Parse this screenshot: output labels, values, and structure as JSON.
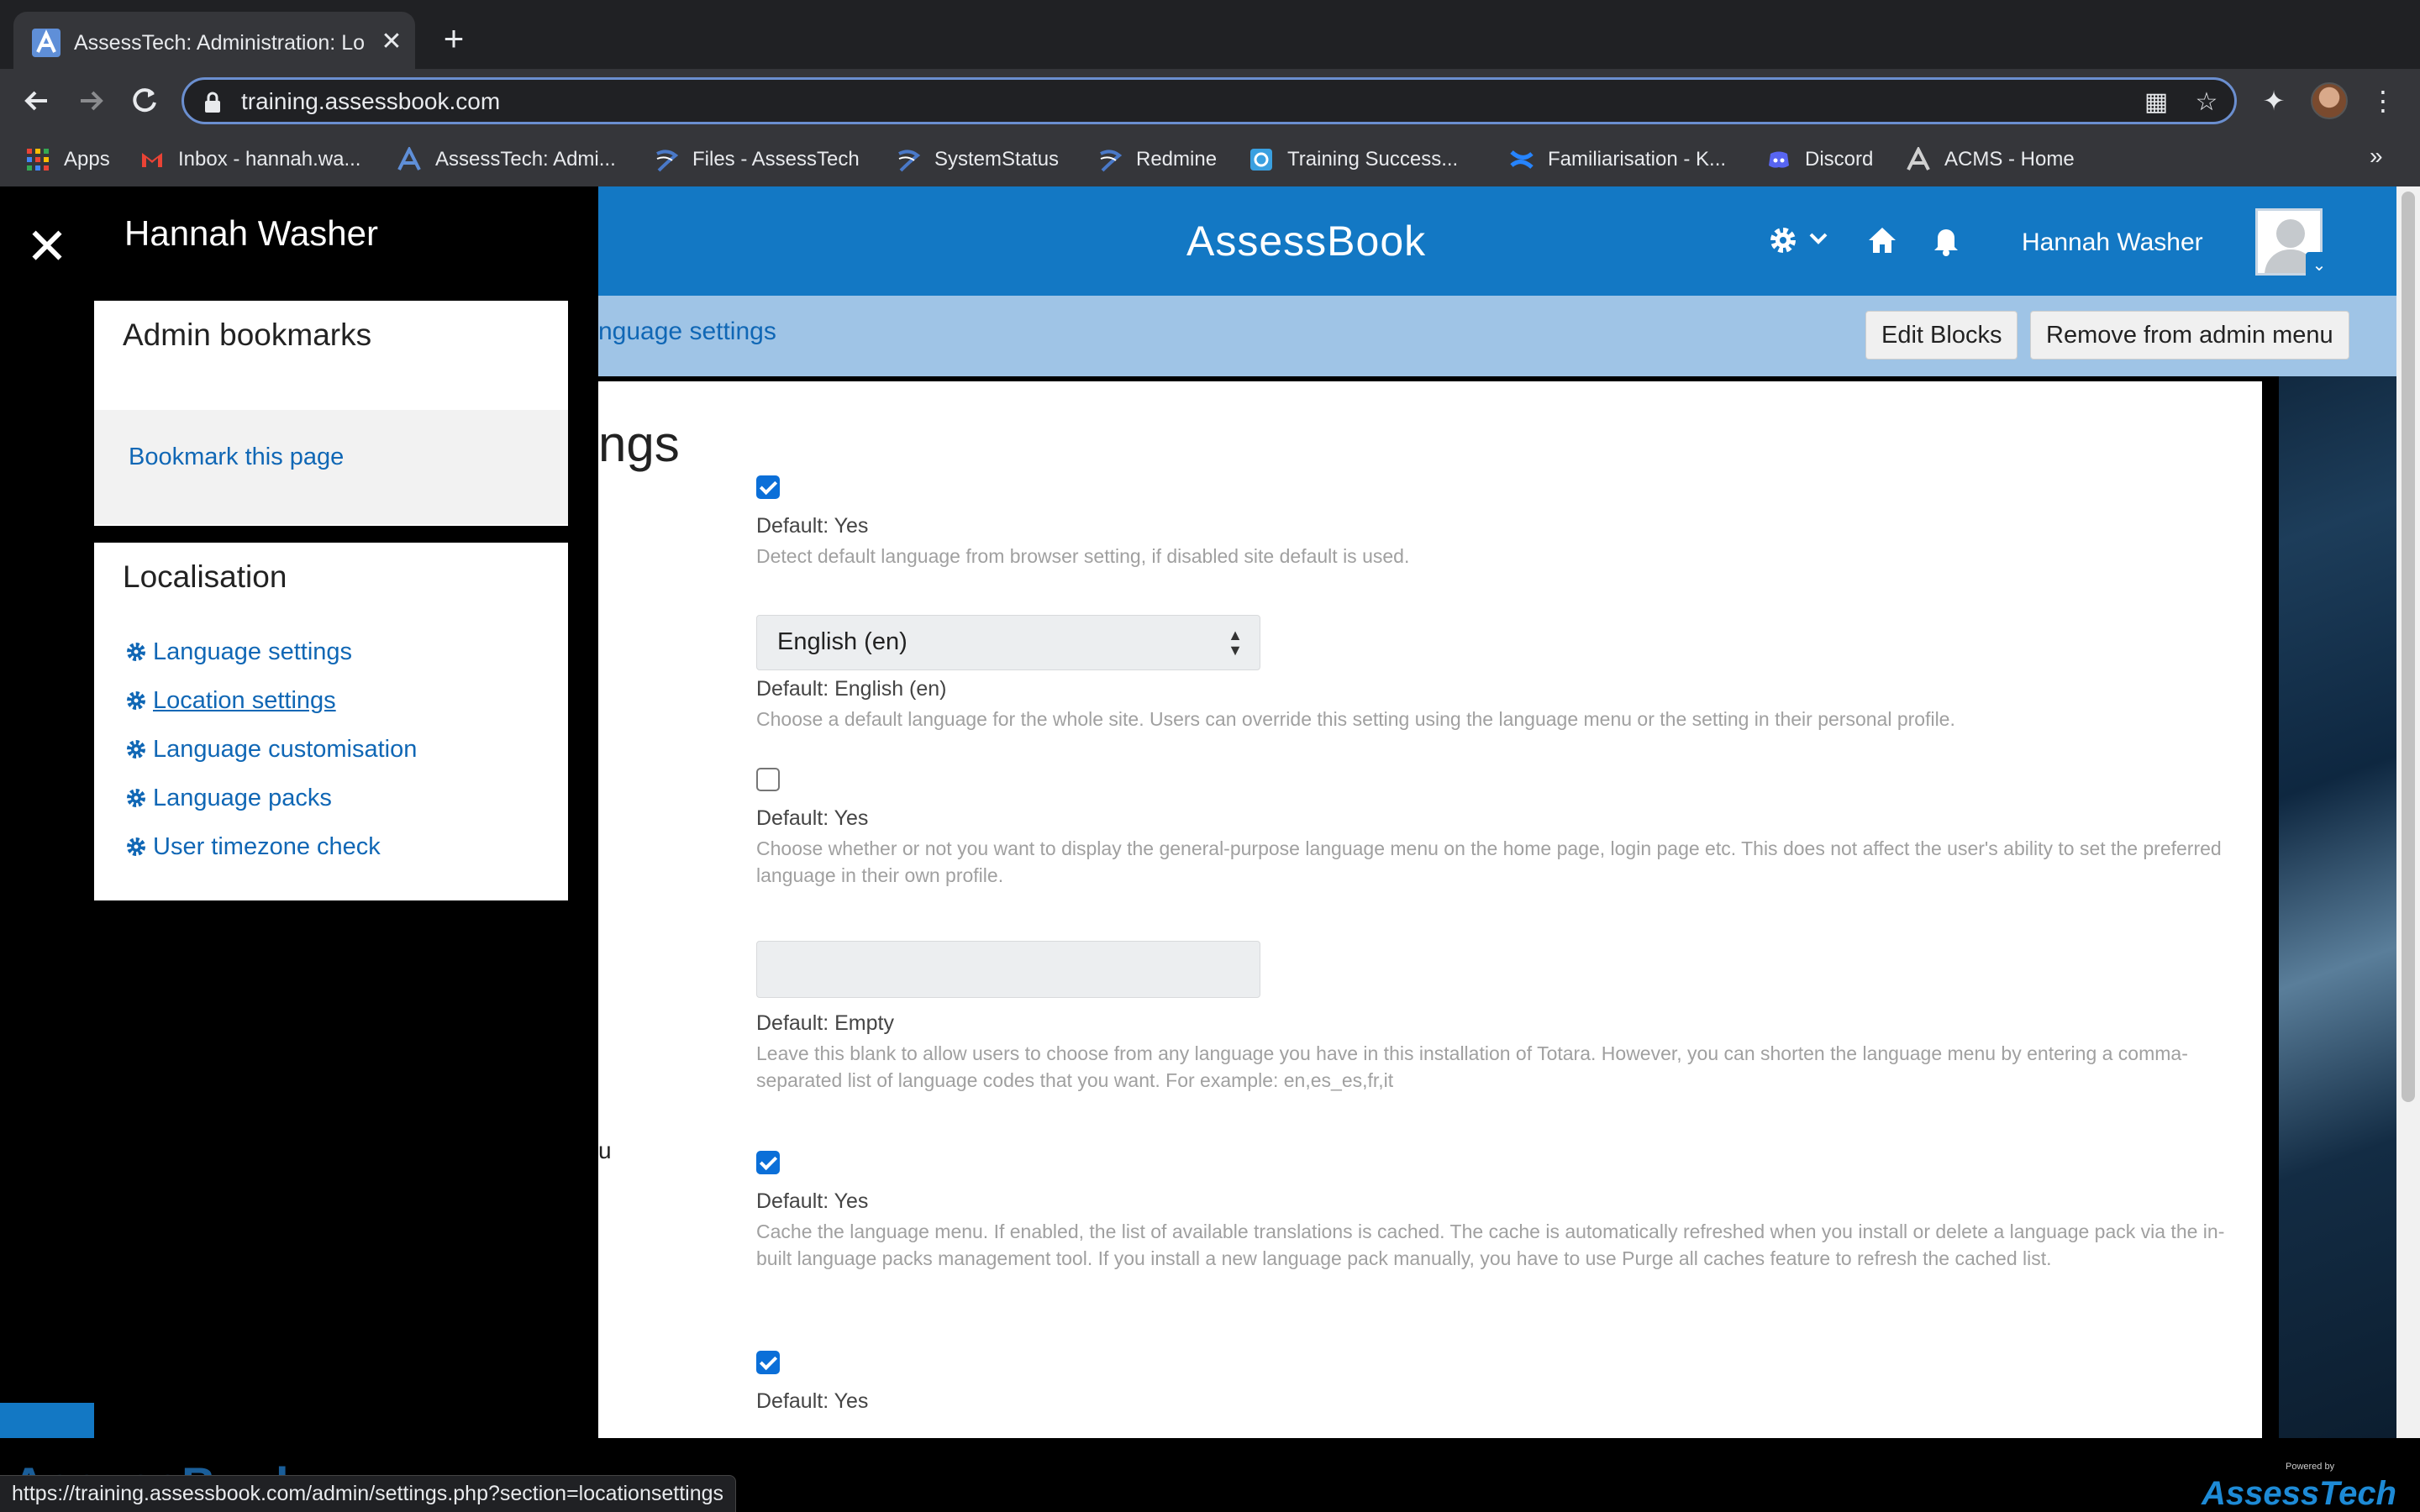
{
  "browser": {
    "tab": {
      "title": "AssessTech: Administration: Lo",
      "close": "✕"
    },
    "new_tab": "+",
    "url": "training.assessbook.com",
    "bookmarks": [
      {
        "label": "Apps",
        "icon": "apps-grid-icon",
        "color": "#ea4335"
      },
      {
        "label": "Inbox - hannah.wa...",
        "icon": "gmail-icon",
        "color": "#ea4335"
      },
      {
        "label": "AssessTech: Admi...",
        "icon": "assesstech-icon",
        "color": "#5f8fd8"
      },
      {
        "label": "Files - AssessTech",
        "icon": "assesstech-swirl-icon",
        "color": "#4a79c8"
      },
      {
        "label": "SystemStatus",
        "icon": "assesstech-swirl-icon",
        "color": "#4a79c8"
      },
      {
        "label": "Redmine",
        "icon": "assesstech-swirl-icon",
        "color": "#4a79c8"
      },
      {
        "label": "Training Success...",
        "icon": "training-icon",
        "color": "#3aa0e0"
      },
      {
        "label": "Familiarisation - K...",
        "icon": "confluence-icon",
        "color": "#2684ff"
      },
      {
        "label": "Discord",
        "icon": "discord-icon",
        "color": "#5865f2"
      },
      {
        "label": "ACMS - Home",
        "icon": "assesstech-icon",
        "color": "#d0d0d0"
      }
    ],
    "bookmarks_more": "»",
    "status_url": "https://training.assessbook.com/admin/settings.php?section=locationsettings"
  },
  "header": {
    "brand": "AssessBook",
    "user_name": "Hannah Washer"
  },
  "subbar": {
    "breadcrumb": "nguage settings",
    "edit_blocks": "Edit Blocks",
    "remove_admin": "Remove from admin menu"
  },
  "main": {
    "heading": "ngs",
    "stray": "u",
    "fields": [
      {
        "type": "checkbox",
        "checked": true,
        "default": "Default: Yes",
        "desc": "Detect default language from browser setting, if disabled site default is used."
      },
      {
        "type": "select",
        "value": "English (en)",
        "default": "Default: English (en)",
        "desc": "Choose a default language for the whole site. Users can override this setting using the language menu or the setting in their personal profile."
      },
      {
        "type": "checkbox",
        "checked": false,
        "default": "Default: Yes",
        "desc": "Choose whether or not you want to display the general-purpose language menu on the home page, login page etc. This does not affect the user's ability to set the preferred language in their own profile."
      },
      {
        "type": "text",
        "value": "",
        "default": "Default: Empty",
        "desc": "Leave this blank to allow users to choose from any language you have in this installation of Totara. However, you can shorten the language menu by entering a comma-separated list of language codes that you want. For example: en,es_es,fr,it"
      },
      {
        "type": "checkbox",
        "checked": true,
        "default": "Default: Yes",
        "desc": "Cache the language menu. If enabled, the list of available translations is cached. The cache is automatically refreshed when you install or delete a language pack via the in-built language packs management tool. If you install a new language pack manually, you have to use Purge all caches feature to refresh the cached list."
      },
      {
        "type": "checkbox",
        "checked": true,
        "default": "Default: Yes",
        "desc": ""
      }
    ]
  },
  "drawer": {
    "user_name": "Hannah Washer",
    "close": "✕",
    "admin_bookmarks": {
      "title": "Admin bookmarks",
      "link": "Bookmark this page"
    },
    "localisation": {
      "title": "Localisation",
      "items": [
        {
          "label": "Language settings",
          "active": false
        },
        {
          "label": "Location settings",
          "active": true
        },
        {
          "label": "Language customisation",
          "active": false
        },
        {
          "label": "Language packs",
          "active": false
        },
        {
          "label": "User timezone check",
          "active": false
        }
      ]
    }
  },
  "footer": {
    "left_logo": "AssessBook",
    "right_logo": "AssessTech",
    "powered_by": "Powered by"
  }
}
